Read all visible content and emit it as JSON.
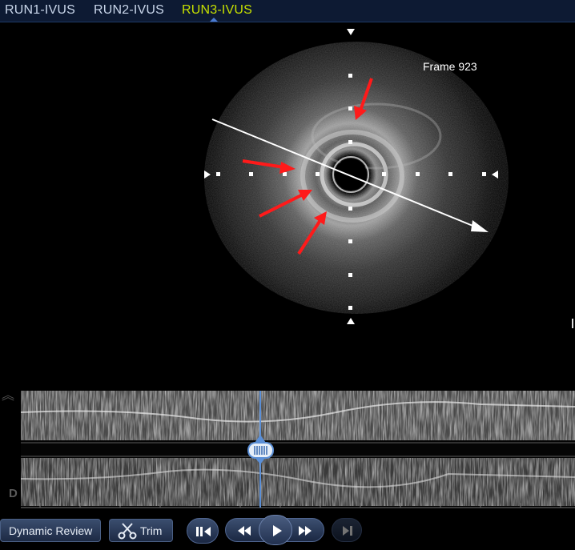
{
  "tabs": [
    {
      "label": "RUN1-IVUS",
      "active": false
    },
    {
      "label": "RUN2-IVUS",
      "active": false
    },
    {
      "label": "RUN3-IVUS",
      "active": true
    }
  ],
  "ivus": {
    "frame_label": "Frame 923",
    "annotation_arrow_color": "#ff1a1a"
  },
  "longitudinal": {
    "side_label": "D"
  },
  "toolbar": {
    "dynamic_review_label": "Dynamic Review",
    "trim_label": "Trim",
    "buttons": [
      "pause-back-icon",
      "rewind-icon",
      "play-icon",
      "fast-forward-icon",
      "skip-end-icon"
    ]
  },
  "colors": {
    "tab_bar": "#0d1a33",
    "active_tab": "#c6e000",
    "inactive_tab": "#c9d6ea",
    "slider_blue": "#5b8fd6",
    "button_fill": "#2a3a58"
  }
}
